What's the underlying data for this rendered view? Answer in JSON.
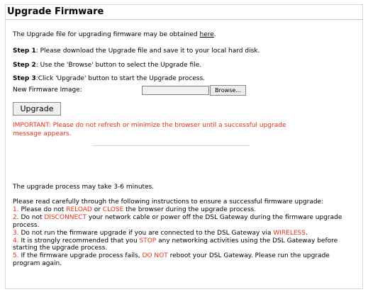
{
  "page": {
    "title": "Upgrade Firmware",
    "intro_prefix": "The Upgrade file for upgrading firmware may be obtained ",
    "intro_link": "here",
    "intro_suffix": ".",
    "step1_label": "Step 1",
    "step1_text": ": Please download the Upgrade file and save it to your local hard disk.",
    "step2_label": "Step 2",
    "step2_text": ": Use the 'Browse' button to select the Upgrade file.",
    "step3_label": "Step 3",
    "step3_text": ":Click 'Upgrade' button to start the Upgrade process.",
    "firmware_label": "New Firmware Image:",
    "file_value": "",
    "browse_label": "Browse...",
    "upgrade_label": "Upgrade",
    "important_text": "IMPORTANT: Please do not refresh or minimize the browser until a successful upgrade message appears.",
    "time_text": "The upgrade process may take 3-6 minutes."
  },
  "instructions": {
    "intro": "Please read carefully through the following instructions to ensure a successful firmware upgrade:",
    "i1_num": "1.",
    "i1_a": " Please do not ",
    "i1_reload": "RELOAD",
    "i1_b": " or ",
    "i1_close": "CLOSE",
    "i1_c": " the browser during the upgrade process.",
    "i2_num": "2.",
    "i2_a": " Do not ",
    "i2_disconnect": "DISCONNECT",
    "i2_b": " your network cable or power off the DSL Gateway during the firmware upgrade process.",
    "i3_num": "3.",
    "i3_a": " Do not run the firmware upgrade if you are connected to the DSL Gateway via ",
    "i3_wireless": "WIRELESS",
    "i3_b": ".",
    "i4_num": "4.",
    "i4_a": " It is strongly recommended that you ",
    "i4_stop": "STOP",
    "i4_b": " any networking activities using the DSL Gateway before starting the upgrade process.",
    "i5_num": "5.",
    "i5_a": " If the firmware upgrade process fails, ",
    "i5_donot": "DO NOT",
    "i5_b": " reboot your DSL Gateway. Please run the upgrade program again."
  },
  "colors": {
    "warning": "#e8301a",
    "border": "#d7d7d7"
  }
}
